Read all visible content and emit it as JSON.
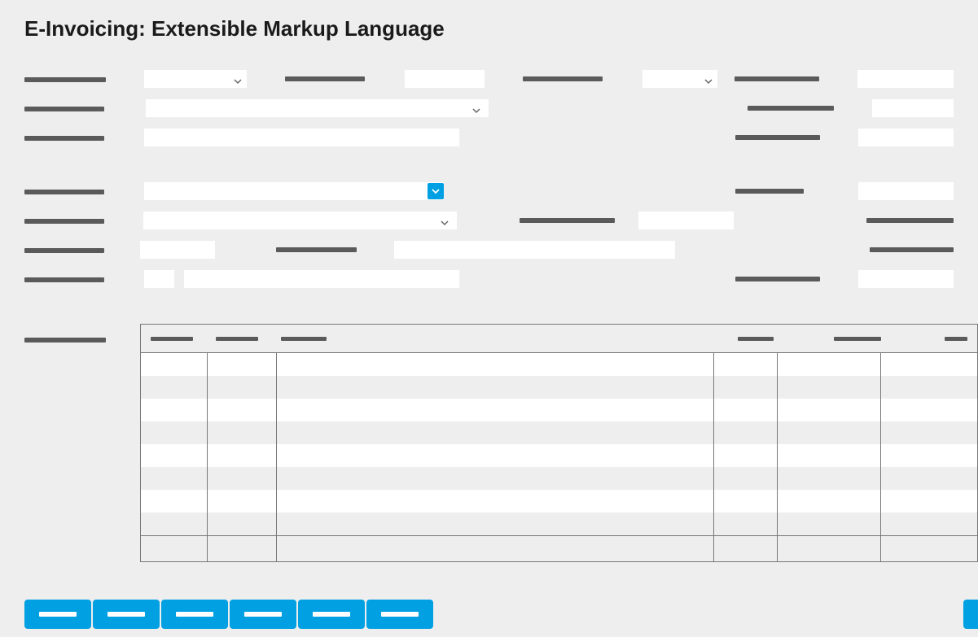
{
  "header": {
    "title": "E-Invoicing: Extensible Markup Language"
  },
  "labels": {
    "r1a": "████████████",
    "r1b": "████████████",
    "r1c": "████████████",
    "r1d": "████████████",
    "r1e": "████████████",
    "r2a": "██████████",
    "r2d": "████████████",
    "r2e": "██████████",
    "r3a": "████████████",
    "r3d": "████████████",
    "r3e": "██████████",
    "r4a": "████████████",
    "r4d": "████████",
    "r5a": "████████████",
    "r5c": "████████████",
    "r5e": "██████████████",
    "r6a": "████████████",
    "r6b": "████████████",
    "r6e": "████████████",
    "r7a": "████████████",
    "r7d": "████████████",
    "r7e": "██████████",
    "tbl": "████████████"
  },
  "table": {
    "headers": [
      "██████",
      "██████",
      "██████",
      "████",
      "███████",
      "████"
    ],
    "rows": 8
  },
  "buttons": {
    "b1": "██████",
    "b2": "██████",
    "b3": "██████",
    "b4": "██████",
    "b5": "██████",
    "b6": "██████"
  }
}
